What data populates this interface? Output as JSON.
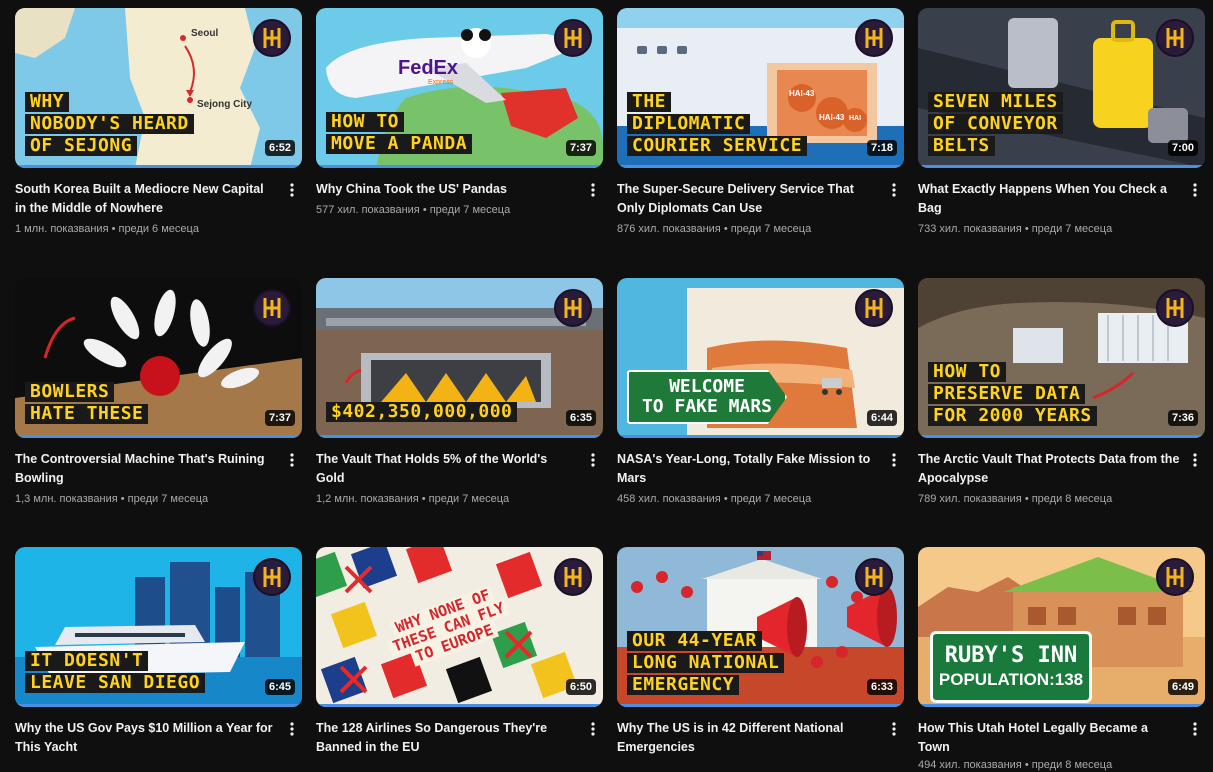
{
  "videos": [
    {
      "caption": [
        "WHY",
        "NOBODY'S HEARD",
        "OF SEJONG"
      ],
      "labels": [
        "Seoul",
        "Sejong City"
      ],
      "duration": "6:52",
      "title": "South Korea Built a Mediocre New Capital in the Middle of Nowhere",
      "stats": "1 млн. показвания • преди 6 месеца"
    },
    {
      "caption": [
        "HOW TO",
        "MOVE A PANDA"
      ],
      "labels": [
        "FedEx",
        "Express"
      ],
      "duration": "7:37",
      "title": "Why China Took the US' Pandas",
      "stats": "577 хил. показвания • преди 7 месеца"
    },
    {
      "caption": [
        "THE",
        "DIPLOMATIC",
        "COURIER SERVICE"
      ],
      "labels": [
        "HAI-43",
        "HAI-43",
        "HAI"
      ],
      "duration": "7:18",
      "title": "The Super-Secure Delivery Service That Only Diplomats Can Use",
      "stats": "876 хил. показвания • преди 7 месеца"
    },
    {
      "caption": [
        "SEVEN MILES",
        "OF CONVEYOR",
        "BELTS"
      ],
      "duration": "7:00",
      "title": "What Exactly Happens When You Check a Bag",
      "stats": "733 хил. показвания • преди 7 месеца"
    },
    {
      "caption": [
        "BOWLERS",
        "HATE THESE"
      ],
      "duration": "7:37",
      "title": "The Controversial Machine That's Ruining Bowling",
      "stats": "1,3 млн. показвания • преди 7 месеца"
    },
    {
      "caption": [
        "$402,350,000,000"
      ],
      "duration": "6:35",
      "title": "The Vault That Holds 5% of the World's Gold",
      "stats": "1,2 млн. показвания • преди 7 месеца"
    },
    {
      "sign": [
        "WELCOME",
        "TO FAKE MARS"
      ],
      "duration": "6:44",
      "title": "NASA's Year-Long, Totally Fake Mission to Mars",
      "stats": "458 хил. показвания • преди 7 месеца"
    },
    {
      "caption": [
        "HOW TO",
        "PRESERVE DATA",
        "FOR 2000 YEARS"
      ],
      "duration": "7:36",
      "title": "The Arctic Vault That Protects Data from the Apocalypse",
      "stats": "789 хил. показвания • преди 8 месеца"
    },
    {
      "caption": [
        "IT DOESN'T",
        "LEAVE SAN DIEGO"
      ],
      "duration": "6:45",
      "title": "Why the US Gov Pays $10 Million a Year for This Yacht",
      "stats": ""
    },
    {
      "banner": [
        "WHY NONE OF",
        "THESE CAN FLY",
        "TO EUROPE"
      ],
      "duration": "6:50",
      "title": "The 128 Airlines So Dangerous They're Banned in the EU",
      "stats": ""
    },
    {
      "caption": [
        "OUR 44-YEAR",
        "LONG NATIONAL",
        "EMERGENCY"
      ],
      "duration": "6:33",
      "title": "Why The US is in 42 Different National Emergencies",
      "stats": ""
    },
    {
      "sign": [
        "RUBY'S INN",
        "POPULATION:138"
      ],
      "duration": "6:49",
      "title": "How This Utah Hotel Legally Became a Town",
      "stats": "494 хил. показвания • преди 8 месеца"
    }
  ],
  "colors": {
    "background": "#0f0f0f",
    "caption_text": "#ffd21f",
    "progress": "#4a90e2",
    "stats_text": "#aaaaaa"
  },
  "icons": {
    "logo": "half-as-interesting-logo-icon",
    "menu": "more-vertical-icon"
  }
}
